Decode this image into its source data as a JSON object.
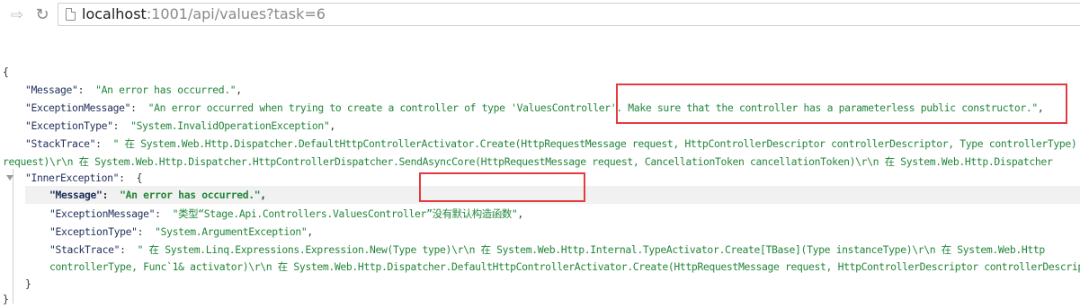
{
  "browser": {
    "back_icon": "⇨",
    "reload_icon": "↻",
    "url_host": "localhost",
    "url_rest": ":1001/api/values?task=6"
  },
  "json": {
    "open_brace": "{",
    "close_brace": "}",
    "message_key": "\"Message\"",
    "message_value": "\"An error has occurred.\"",
    "exception_message_key": "\"ExceptionMessage\"",
    "exception_message_value": "\"An error occurred when trying to create a controller of type 'ValuesController'. Make sure that the controller has a parameterless public constructor.\"",
    "exception_type_key": "\"ExceptionType\"",
    "exception_type_value": "\"System.InvalidOperationException\"",
    "stack_trace_key": "\"StackTrace\"",
    "stack_trace_line1": "\"   在 System.Web.Http.Dispatcher.DefaultHttpControllerActivator.Create(HttpRequestMessage request, HttpControllerDescriptor controllerDescriptor, Type controllerType)",
    "stack_trace_line2": "request)\\r\\n   在 System.Web.Http.Dispatcher.HttpControllerDispatcher.SendAsyncCore(HttpRequestMessage request, CancellationToken cancellationToken)\\r\\n   在 System.Web.Http.Dispatcher",
    "inner_exception_key": "\"InnerException\"",
    "inner": {
      "message_key": "\"Message\"",
      "message_value": "\"An error has occurred.\"",
      "exception_message_key": "\"ExceptionMessage\"",
      "exception_message_value": "\"类型“Stage.Api.Controllers.ValuesController”没有默认构造函数\"",
      "exception_type_key": "\"ExceptionType\"",
      "exception_type_value": "\"System.ArgumentException\"",
      "stack_trace_key": "\"StackTrace\"",
      "stack_trace_line1": "\"   在 System.Linq.Expressions.Expression.New(Type type)\\r\\n   在 System.Web.Http.Internal.TypeActivator.Create[TBase](Type instanceType)\\r\\n   在 System.Web.Http",
      "stack_trace_line2": "controllerType, Func`1& activator)\\r\\n   在 System.Web.Http.Dispatcher.DefaultHttpControllerActivator.Create(HttpRequestMessage request, HttpControllerDescriptor controllerDescriptor"
    }
  },
  "colors": {
    "key": "#1f2f5a",
    "string": "#23863a",
    "annotation_box": "#e33b3f"
  }
}
